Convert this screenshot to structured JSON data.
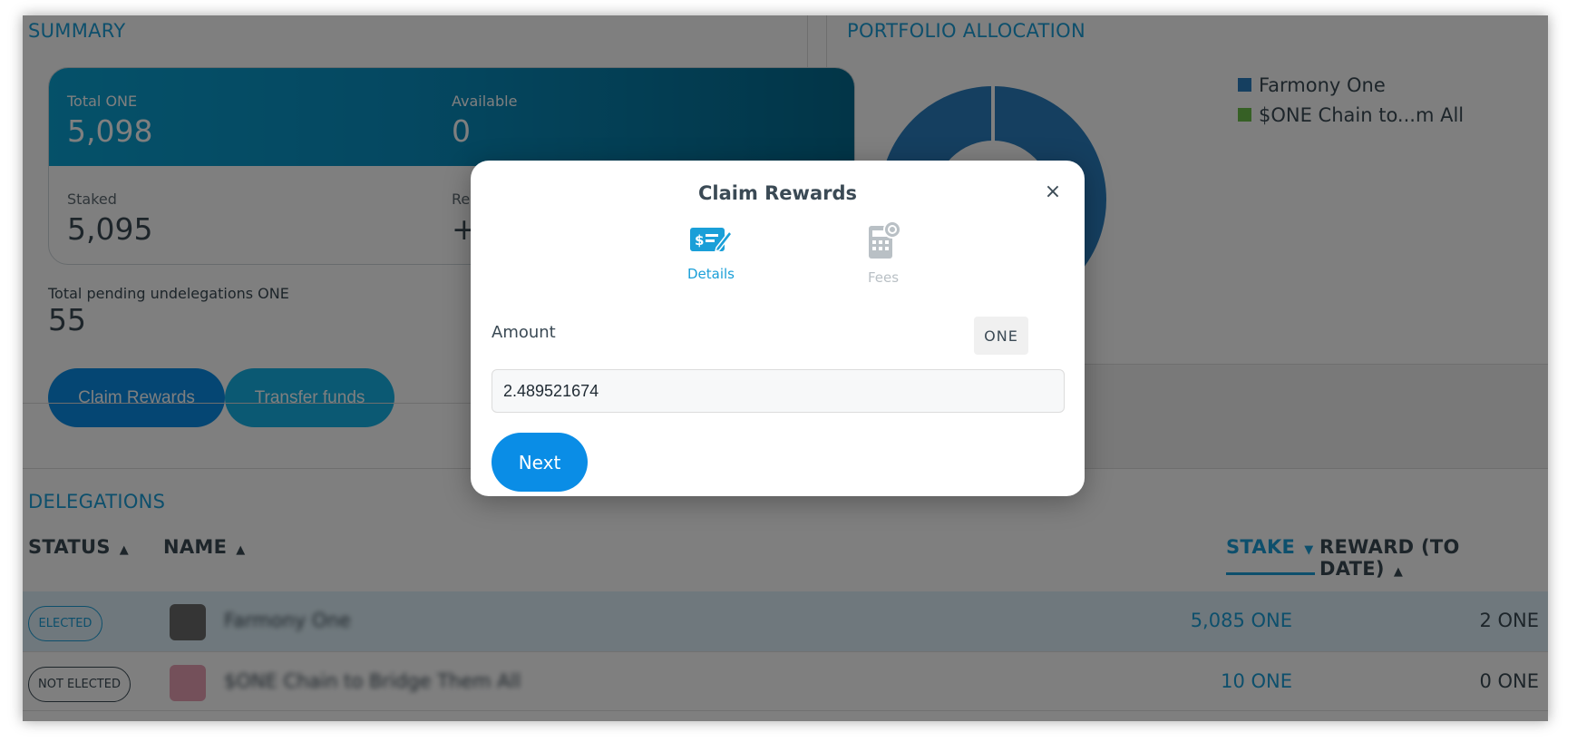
{
  "summary": {
    "title": "SUMMARY",
    "total_label": "Total ONE",
    "total_value": "5,098",
    "available_label": "Available",
    "available_value": "0",
    "staked_label": "Staked",
    "staked_value": "5,095",
    "rewards_label": "Re",
    "rewards_value": "+",
    "pending_label": "Total pending undelegations ONE",
    "pending_value": "55",
    "claim_button": "Claim Rewards",
    "transfer_button": "Transfer funds"
  },
  "portfolio": {
    "title": "PORTFOLIO ALLOCATION",
    "legend": [
      {
        "label": "Farmony One",
        "color": "#2a7fc1"
      },
      {
        "label": "$ONE Chain to...m All",
        "color": "#6cc04a"
      }
    ]
  },
  "delegations": {
    "title": "DELEGATIONS",
    "headers": {
      "status": "STATUS",
      "name": "NAME",
      "stake": "STAKE",
      "reward": "REWARD (TO DATE)"
    },
    "rows": [
      {
        "status": "ELECTED",
        "name": "Farmony One",
        "stake": "5,085 ONE",
        "reward": "2 ONE"
      },
      {
        "status": "NOT ELECTED",
        "name": "$ONE Chain to Bridge Them All",
        "stake": "10 ONE",
        "reward": "0 ONE"
      }
    ]
  },
  "modal": {
    "title": "Claim Rewards",
    "close_icon": "×",
    "steps": [
      {
        "label": "Details",
        "icon": "cheque-icon"
      },
      {
        "label": "Fees",
        "icon": "calculator-icon"
      }
    ],
    "amount_label": "Amount",
    "unit": "ONE",
    "amount_value": "2.489521674",
    "next_button": "Next"
  },
  "colors": {
    "accent": "#1a9fd8",
    "button": "#0a8de6"
  }
}
